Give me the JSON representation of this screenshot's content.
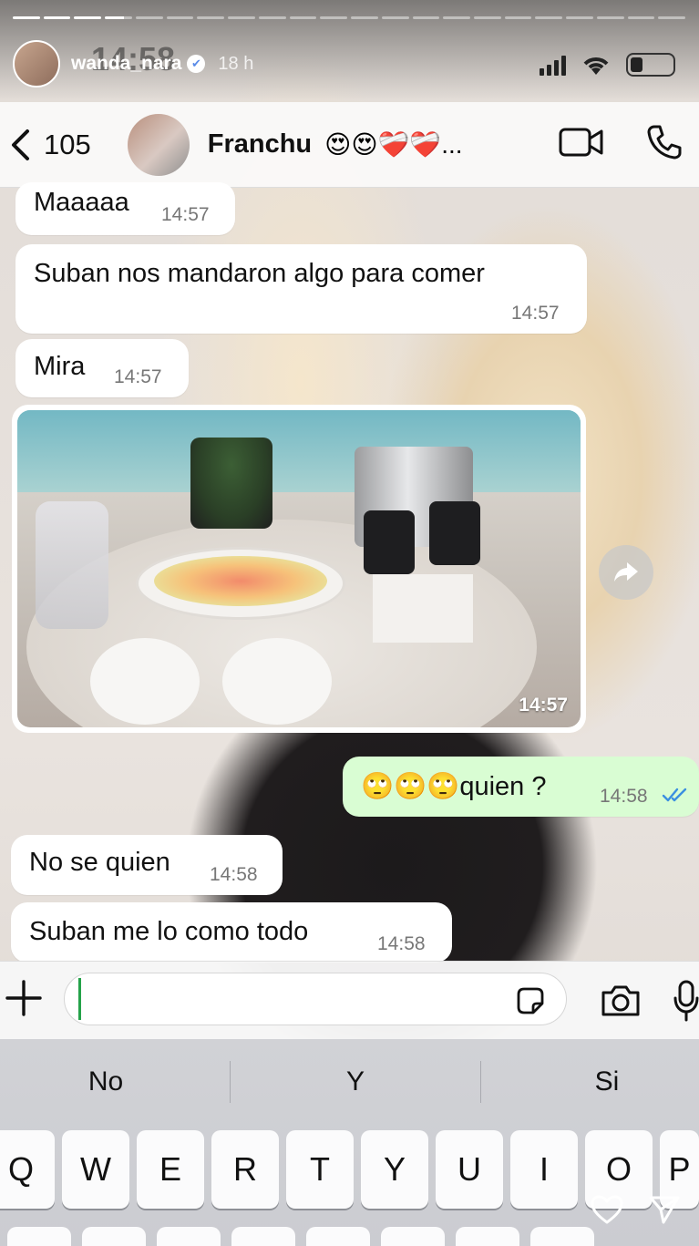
{
  "story": {
    "username": "wanda_nara",
    "verified_mark": "✔",
    "time_ago": "18 h",
    "progress": {
      "segments_total": 22,
      "segments_done": 4,
      "current_fraction": 0.7
    },
    "footer": {
      "like_icon": "heart-icon",
      "share_icon": "send-icon"
    }
  },
  "status_bar": {
    "clock": "14:58"
  },
  "chat_header": {
    "back_count": "105",
    "contact_name": "Franchu",
    "contact_emojis": "😍😍❤️‍🩹❤️‍🩹...",
    "actions": [
      "video-call-icon",
      "phone-icon"
    ]
  },
  "messages": [
    {
      "direction": "in",
      "text": "Maaaaa",
      "time": "14:57"
    },
    {
      "direction": "in",
      "text": "Suban nos mandaron algo para comer",
      "time": "14:57"
    },
    {
      "direction": "in",
      "text": "Mira",
      "time": "14:57"
    },
    {
      "direction": "in",
      "type": "image",
      "time": "14:57"
    },
    {
      "direction": "out",
      "text": "🙄🙄🙄quien ?",
      "time": "14:58",
      "status": "read"
    },
    {
      "direction": "in",
      "text": "No se quien",
      "time": "14:58"
    },
    {
      "direction": "in",
      "text": "Suban me lo como todo",
      "time": "14:58"
    }
  ],
  "input": {
    "value": "",
    "placeholder": ""
  },
  "keyboard": {
    "suggestions": [
      "No",
      "Y",
      "Si"
    ],
    "row1": [
      "Q",
      "W",
      "E",
      "R",
      "T",
      "Y",
      "U",
      "I",
      "O",
      "P"
    ]
  },
  "colors": {
    "outgoing_bubble": "#d9fdd3",
    "incoming_bubble": "#ffffff",
    "read_ticks": "#3b8fe0",
    "caret": "#25a24a"
  }
}
